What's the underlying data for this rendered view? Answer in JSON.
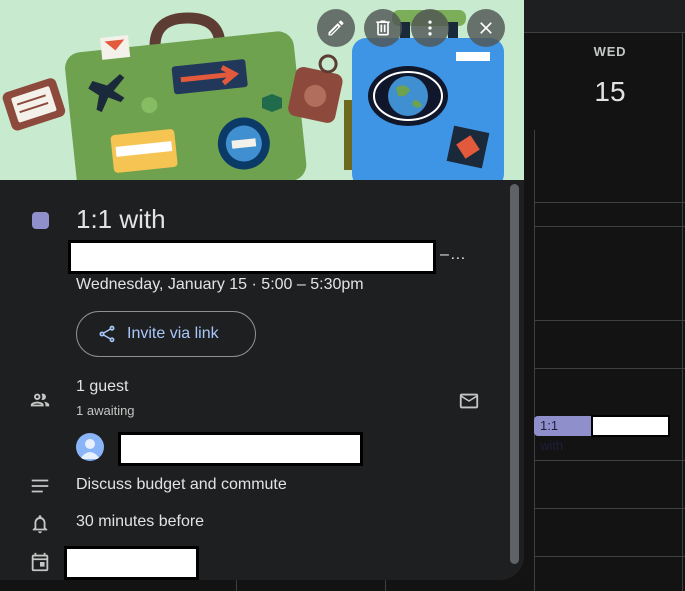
{
  "calendar": {
    "day_name": "WED",
    "day_number": "15",
    "event_chip_label": "1:1 with"
  },
  "event": {
    "color": "#8f8fcc",
    "title": "1:1 with",
    "title_overflow": "–…",
    "datetime": "Wednesday, January 15  ·  5:00 – 5:30pm",
    "invite_label": "Invite via link",
    "guests": {
      "count_label": "1 guest",
      "status_label": "1 awaiting"
    },
    "description": "Discuss budget and commute",
    "reminder": "30 minutes before"
  },
  "toolbar": {
    "icons": [
      "edit-icon",
      "delete-icon",
      "more-icon",
      "close-icon"
    ]
  }
}
